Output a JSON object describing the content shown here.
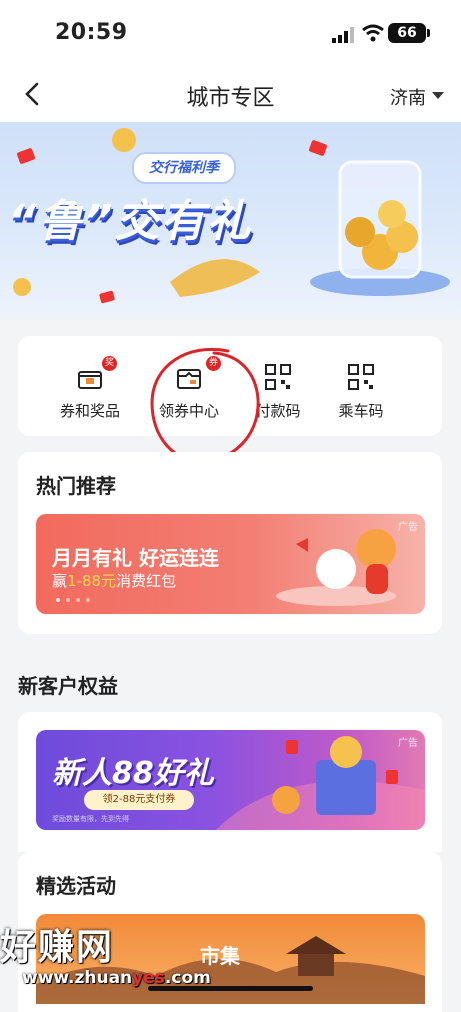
{
  "status_bar": {
    "time": "20:59",
    "battery": "66"
  },
  "nav": {
    "title": "城市专区",
    "city": "济南"
  },
  "banner": {
    "tag": "交行福利季",
    "headline": "“鲁”交有礼"
  },
  "quick_entries": [
    {
      "label": "券和奖品",
      "icon": "gift-box-icon",
      "badge": "奖"
    },
    {
      "label": "领券中心",
      "icon": "coupon-icon",
      "badge": "券"
    },
    {
      "label": "付款码",
      "icon": "qr-code-icon",
      "badge": ""
    },
    {
      "label": "乘车码",
      "icon": "qr-code-icon",
      "badge": ""
    }
  ],
  "hot": {
    "title": "热门推荐",
    "promo": {
      "title": "月月有礼 好运连连",
      "sub_prefix": "赢",
      "sub_highlight": "1-88元",
      "sub_suffix": "消费红包",
      "ad": "广告"
    }
  },
  "new_customer": {
    "title": "新客户权益",
    "promo": {
      "title": "新人88好礼",
      "pill": "领2-88元支付券",
      "note": "奖励数量有限，先到先得",
      "ad": "广告"
    }
  },
  "selected": {
    "title": "精选活动",
    "promo": {
      "text": "市集"
    }
  },
  "watermark": {
    "text": "好赚网",
    "url_a": "www.zhuan",
    "url_b": "yes",
    "url_c": ".com"
  },
  "colors": {
    "accent_red": "#e02424",
    "annotation": "#d8262a",
    "brand_blue": "#3a63d8"
  }
}
